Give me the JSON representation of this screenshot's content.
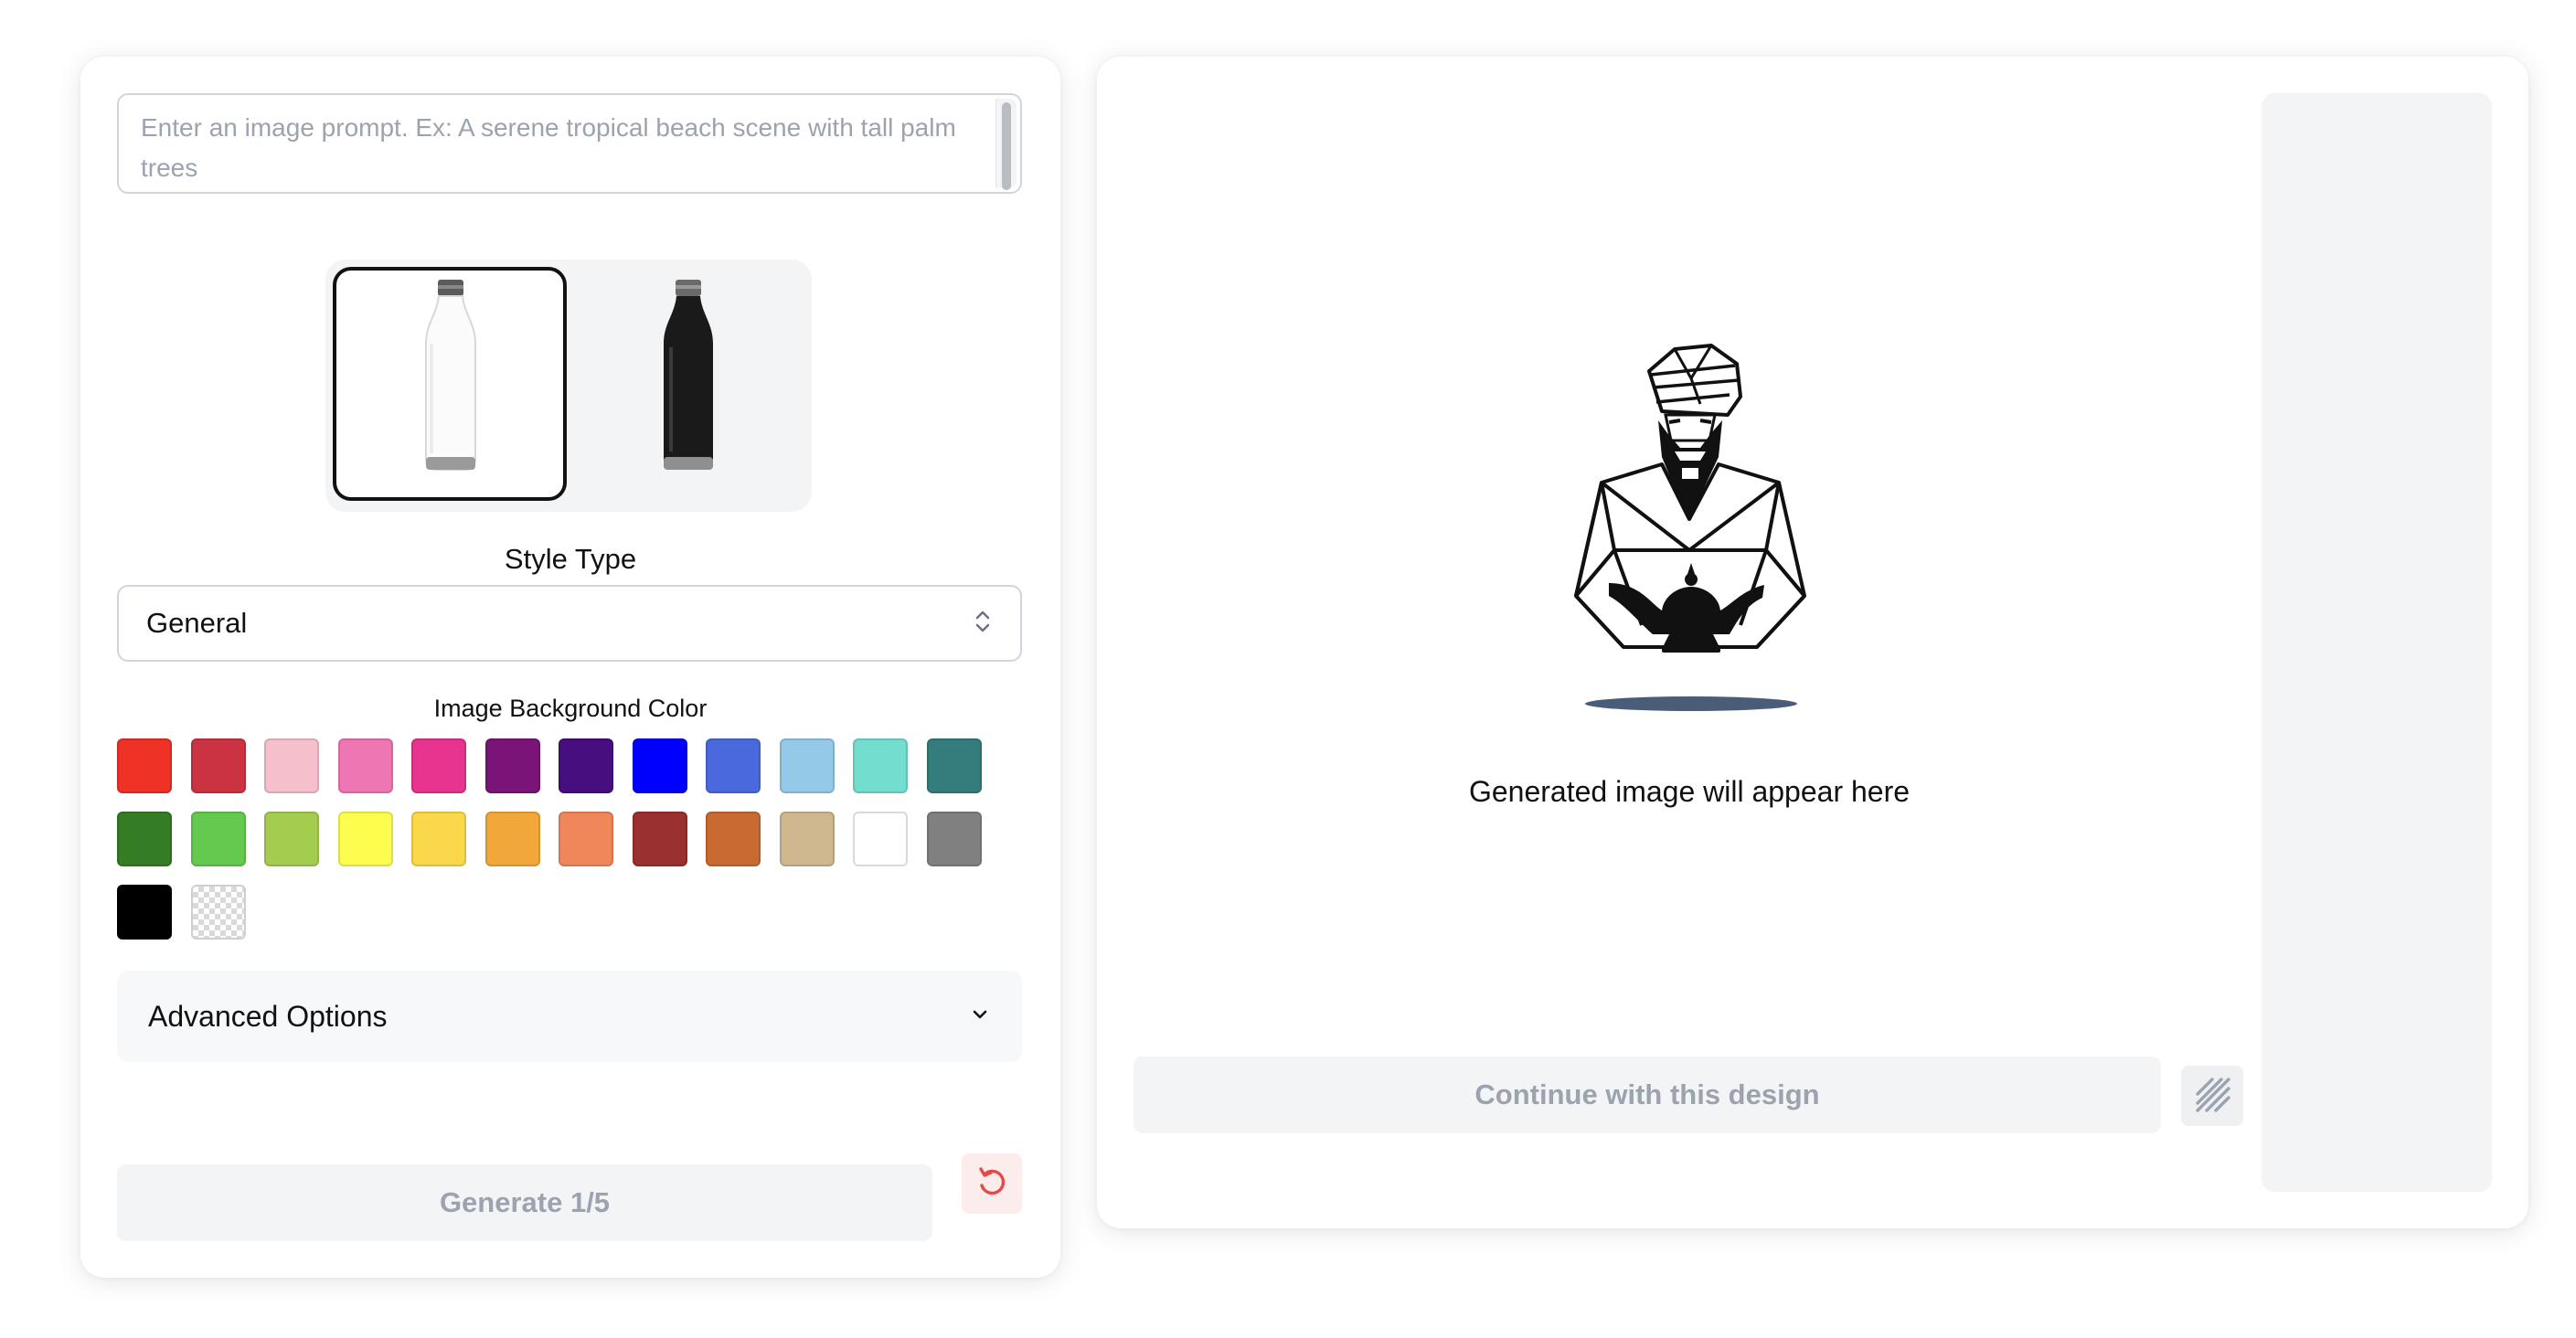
{
  "prompt": {
    "placeholder": "Enter an image prompt. Ex: A serene tropical beach scene with tall palm trees"
  },
  "products": [
    {
      "name": "White bottle",
      "color": "#ffffff",
      "selected": true
    },
    {
      "name": "Black bottle",
      "color": "#1a1a1a",
      "selected": false
    }
  ],
  "style": {
    "label": "Style Type",
    "value": "General"
  },
  "background": {
    "label": "Image Background Color",
    "colors": [
      "#ee3226",
      "#cc3342",
      "#f5c0cc",
      "#ee77b3",
      "#e8348e",
      "#7b1479",
      "#470e80",
      "#0000ff",
      "#4a69dd",
      "#94c9e8",
      "#73ddcf",
      "#347d7c",
      "#347d24",
      "#64ca4f",
      "#a4cd50",
      "#fdfd4f",
      "#fbd74a",
      "#f2a73b",
      "#ef875a",
      "#9a3030",
      "#c86a31",
      "#cfb790",
      "#ffffff",
      "#808080",
      "#000000",
      "transparent"
    ]
  },
  "advanced": {
    "label": "Advanced Options"
  },
  "generate": {
    "label": "Generate 1/5"
  },
  "preview": {
    "placeholder": "Generated image will appear here"
  },
  "continue": {
    "label": "Continue with this design"
  },
  "icons": {
    "select": "chevron-up-down-icon",
    "advanced": "chevron-down-icon",
    "reset": "reset-icon",
    "pattern": "pattern-icon",
    "genie": "genie-logo"
  }
}
